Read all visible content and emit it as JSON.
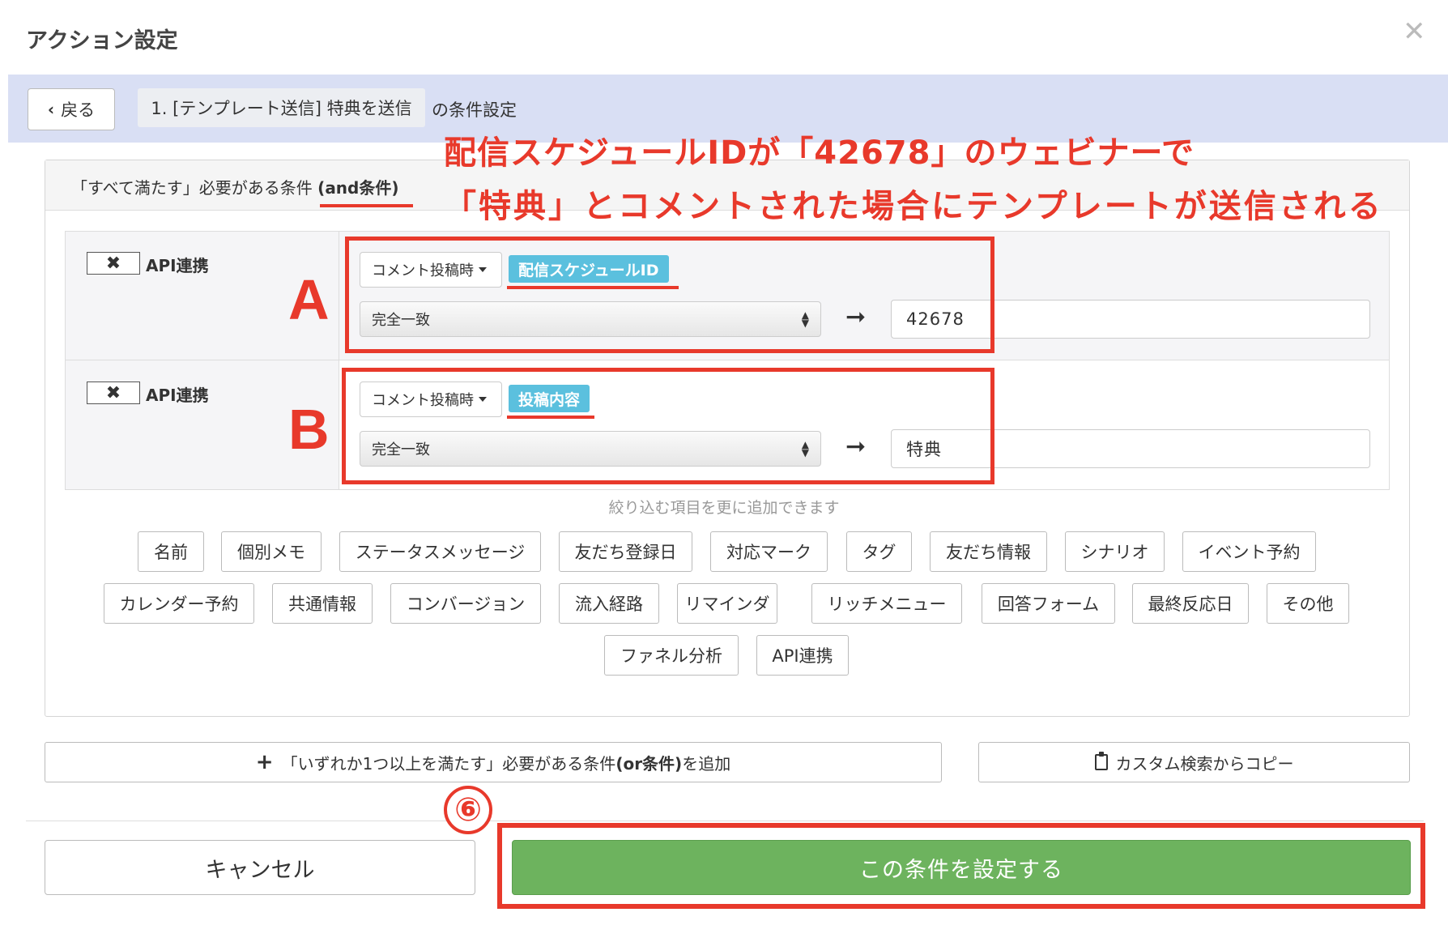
{
  "modal": {
    "title": "アクション設定",
    "close_icon": "close-icon"
  },
  "breadcrumb": {
    "back_label": "戻る",
    "current": "1. [テンプレート送信] 特典を送信",
    "suffix": "の条件設定"
  },
  "annotation": {
    "line1": "配信スケジュールIDが「42678」のウェビナーで",
    "line2": "「特典」とコメントされた場合にテンプレートが送信される",
    "label_a": "A",
    "label_b": "B",
    "step": "⑥",
    "color": "#e8392b"
  },
  "and_group": {
    "label_prefix": "「すべて満たす」必要がある条件 ",
    "label_bold": "(and条件)"
  },
  "conditions": [
    {
      "remove": "✖",
      "name": "API連携",
      "trigger": "コメント投稿時",
      "field": "配信スケジュールID",
      "match": "完全一致",
      "value": "42678"
    },
    {
      "remove": "✖",
      "name": "API連携",
      "trigger": "コメント投稿時",
      "field": "投稿内容",
      "match": "完全一致",
      "value": "特典"
    }
  ],
  "hint": "絞り込む項目を更に追加できます",
  "chips": [
    [
      "名前",
      "個別メモ",
      "ステータスメッセージ",
      "友だち登録日",
      "対応マーク",
      "タグ",
      "友だち情報",
      "シナリオ",
      "イベント予約"
    ],
    [
      "カレンダー予約",
      "共通情報",
      "コンバージョン",
      "流入経路",
      "リマインダ",
      "リッチメニュー",
      "回答フォーム",
      "最終反応日",
      "その他"
    ],
    [
      "ファネル分析",
      "API連携"
    ]
  ],
  "actions": {
    "add_or_prefix": "「いずれか1つ以上を満たす」必要がある条件",
    "add_or_bold": "(or条件)",
    "add_or_suffix": "を追加",
    "copy_label": "カスタム検索からコピー",
    "cancel_label": "キャンセル",
    "confirm_label": "この条件を設定する"
  },
  "colors": {
    "header_bar": "#d9dff4",
    "tag": "#5bc0de",
    "confirm": "#6db35e",
    "annotation": "#e8392b"
  }
}
